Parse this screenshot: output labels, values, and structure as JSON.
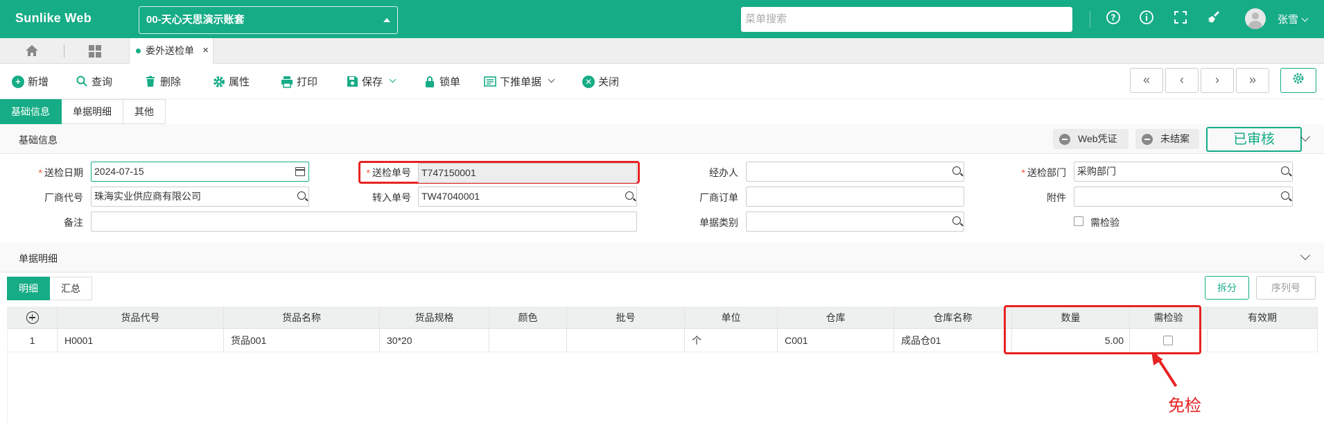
{
  "app": {
    "brand": "Sunlike Web",
    "account": "00-天心天思演示账套",
    "menu_search_placeholder": "菜单搜索",
    "user": "张雪"
  },
  "icons": {
    "help": "question-circle-icon",
    "info": "info-circle-icon",
    "fullscreen": "fullscreen-icon",
    "clean": "broom-icon",
    "home": "home-icon",
    "apps": "grid-icon"
  },
  "page_tab": {
    "label": "委外送检单"
  },
  "toolbar": {
    "add": "新增",
    "query": "查询",
    "delete": "删除",
    "properties": "属性",
    "print": "打印",
    "save": "保存",
    "lock": "锁单",
    "push_down": "下推单据",
    "close": "关闭"
  },
  "nav": {
    "first": "«",
    "prev": "‹",
    "next": "›",
    "last": "»"
  },
  "main_tabs": [
    "基础信息",
    "单据明细",
    "其他"
  ],
  "basic": {
    "title": "基础信息",
    "web_voucher": "Web凭证",
    "not_closed": "未结案",
    "status": "已审核",
    "fields": {
      "date_label": "送检日期",
      "date_value": "2024-07-15",
      "no_label": "送检单号",
      "no_value": "T747150001",
      "handler_label": "经办人",
      "handler_value": "",
      "dept_label": "送检部门",
      "dept_value": "采购部门",
      "vendor_label": "厂商代号",
      "vendor_value": "珠海实业供应商有限公司",
      "transfer_label": "转入单号",
      "transfer_value": "TW47040001",
      "vendor_order_label": "厂商订单",
      "vendor_order_value": "",
      "attach_label": "附件",
      "attach_value": "",
      "remark_label": "备注",
      "remark_value": "",
      "doc_type_label": "单据类别",
      "doc_type_value": "",
      "need_inspect_label": "需检验"
    }
  },
  "detail": {
    "title": "单据明细",
    "tabs": [
      "明细",
      "汇总"
    ],
    "split": "拆分",
    "serial": "序列号",
    "columns": [
      "货品代号",
      "货品名称",
      "货品规格",
      "颜色",
      "批号",
      "单位",
      "仓库",
      "仓库名称",
      "数量",
      "需检验",
      "有效期"
    ],
    "rows": [
      {
        "idx": "1",
        "code": "H0001",
        "name": "货品001",
        "spec": "30*20",
        "color": "",
        "batch": "",
        "unit": "个",
        "wh": "C001",
        "wh_name": "成品仓01",
        "qty": "5.00",
        "need": false,
        "expire": ""
      }
    ]
  },
  "annotation": {
    "text": "免检",
    "color": "#e82222"
  },
  "colors": {
    "primary": "#16ac86",
    "highlight": "#e82222"
  }
}
